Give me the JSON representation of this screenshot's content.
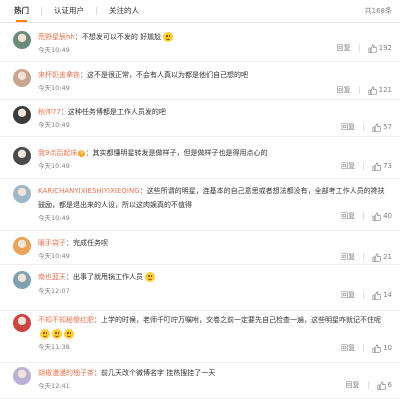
{
  "tabs": {
    "hot": "热门",
    "verified": "认证用户",
    "following": "关注的人",
    "total": "共168条"
  },
  "comments": [
    {
      "user": "荒野星辰hh",
      "sep": "：",
      "text": "不想发可以不发的 好尴尬",
      "emoji": true,
      "time": "今天10:49",
      "reply": "回复",
      "likes": "192",
      "verified": false
    },
    {
      "user": "来杯奶盖拿铁",
      "sep": "：",
      "text": "这不是很正常，不会有人真以为都是他们自己想的吧",
      "emoji": false,
      "time": "今天10:49",
      "reply": "回复",
      "likes": "121",
      "verified": false
    },
    {
      "user": "秋帅77",
      "sep": "：",
      "text": "这种任务博都是工作人员发的吧",
      "emoji": false,
      "time": "今天10:49",
      "reply": "回复",
      "likes": "57",
      "verified": false
    },
    {
      "user": "我9点后起床",
      "sep": "：",
      "text": "其实都懂明星转发是做样子，但是做样子也是得用点心的",
      "emoji": false,
      "time": "今天10:49",
      "reply": "回复",
      "likes": "73",
      "verified": true
    },
    {
      "user": "KARICHANYIXIESHIYIXIEQING",
      "sep": "：",
      "text": "这些所谓的明星，连基本的自己意思或者想法都没有，全部考工作人员的搀扶鼓励，都是退出来的人设，所以这肉娱真的不值得",
      "emoji": false,
      "time": "今天10:49",
      "reply": "回复",
      "likes": "40",
      "verified": false
    },
    {
      "user": "暖手袋子",
      "sep": "：",
      "text": "完成任务呗",
      "emoji": false,
      "time": "今天10:49",
      "reply": "回复",
      "likes": "21",
      "verified": false
    },
    {
      "user": "南也蓝天",
      "sep": "：",
      "text": "出事了就甩锅工作人员",
      "emoji": true,
      "time": "今天12:07",
      "reply": "回复",
      "likes": "14",
      "verified": false
    },
    {
      "user": "不知不知秘傻红肥",
      "sep": "：",
      "text": "上学的时候，老师千叮咛万嘱咐，交卷之前一定要先自己检查一遍，这些明星咋就记不住呢",
      "emoji": true,
      "time": "今天11:38",
      "reply": "回复",
      "likes": "10",
      "verified": false
    },
    {
      "user": "胡椒漫漫的柚子茶",
      "sep": "：",
      "text": "前几天改个微博名字 挂热搜挂了一天",
      "emoji": false,
      "time": "今天12:41",
      "reply": "回复",
      "likes": "6",
      "verified": false
    }
  ],
  "colors": {
    "accent": "#ff8200",
    "username": "#eb7350",
    "meta": "#808080"
  }
}
